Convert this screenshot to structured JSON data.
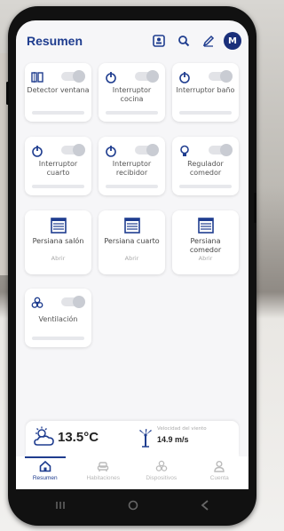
{
  "header": {
    "title": "Resumen",
    "avatar_initial": "M"
  },
  "cards": [
    {
      "label": "Detector ventana",
      "icon": "door-sensor-icon"
    },
    {
      "label": "Interruptor cocina",
      "icon": "power-icon"
    },
    {
      "label": "Interruptor baño",
      "icon": "power-icon"
    },
    {
      "label": "Interruptor cuarto",
      "icon": "power-icon"
    },
    {
      "label": "Interruptor recibidor",
      "icon": "power-icon"
    },
    {
      "label": "Regulador comedor",
      "icon": "bulb-icon"
    }
  ],
  "blinds": [
    {
      "label": "Persiana salón",
      "status": "Abrir"
    },
    {
      "label": "Persiana cuarto",
      "status": "Abrir"
    },
    {
      "label": "Persiana comedor",
      "status": "Abrir"
    }
  ],
  "fan": {
    "label": "Ventilación",
    "icon": "fan-icon"
  },
  "weather": {
    "temperature": "13.5°C",
    "wind_label": "Velocidad del viento",
    "wind_value": "14.9 m/s"
  },
  "nav": [
    {
      "label": "Resumen",
      "icon": "home-icon",
      "active": true
    },
    {
      "label": "Habitaciones",
      "icon": "sofa-icon",
      "active": false
    },
    {
      "label": "Dispositivos",
      "icon": "devices-icon",
      "active": false
    },
    {
      "label": "Cuenta",
      "icon": "user-icon",
      "active": false
    }
  ],
  "colors": {
    "accent": "#1f3d8f",
    "card": "#ffffff",
    "background": "#f6f6f8"
  }
}
